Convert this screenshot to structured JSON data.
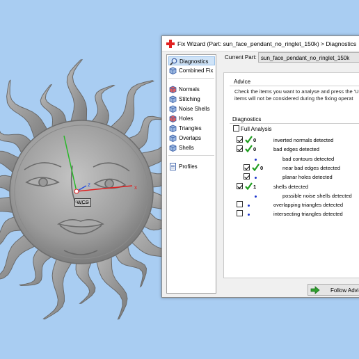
{
  "viewport": {
    "background": "#a9cdf2",
    "model_color": "#9a9a9a",
    "axes": {
      "x_label": "x",
      "z_label": "z",
      "x_color": "#e02020",
      "y_color": "#28b828",
      "z_color": "#2850e0"
    },
    "wcs_label": "WCS"
  },
  "dialog": {
    "title": "Fix Wizard (Part: sun_face_pendant_no_ringlet_150k) > Diagnostics",
    "title_icon": "red-cross-icon",
    "current_part_label": "Current Part:",
    "current_part_value": "sun_face_pendant_no_ringlet_150k",
    "nav": [
      {
        "label": "Diagnostics",
        "icon": "magnifier-icon",
        "selected": true
      },
      {
        "label": "Combined Fix",
        "icon": "cube-icon"
      },
      {
        "label": "Normals",
        "icon": "cube-icon"
      },
      {
        "label": "Stitching",
        "icon": "cube-icon"
      },
      {
        "label": "Noise Shells",
        "icon": "cube-icon"
      },
      {
        "label": "Holes",
        "icon": "cube-icon"
      },
      {
        "label": "Triangles",
        "icon": "cube-icon"
      },
      {
        "label": "Overlaps",
        "icon": "cube-icon"
      },
      {
        "label": "Shells",
        "icon": "cube-icon"
      },
      {
        "label": "Profiles",
        "icon": "document-icon"
      }
    ],
    "advice": {
      "title": "Advice",
      "line1": "Check the items you want to analyse and press the 'U",
      "line2": "items will not be considered during the fixing operat"
    },
    "diagnostics": {
      "title": "Diagnostics",
      "full_analysis_label": "Full Analysis",
      "full_analysis_checked": false,
      "rows": [
        {
          "label": "inverted normals detected",
          "checked": true,
          "ok": true,
          "count": "0"
        },
        {
          "label": "bad edges detected",
          "checked": true,
          "ok": true,
          "count": "0"
        },
        {
          "label": "bad contours detected",
          "sub": true,
          "checked": null,
          "ok": false,
          "count": ""
        },
        {
          "label": "near bad edges detected",
          "sub": true,
          "checked": true,
          "ok": true,
          "count": "0"
        },
        {
          "label": "planar holes detected",
          "sub": true,
          "checked": true,
          "ok": false,
          "count": ""
        },
        {
          "label": "shells detected",
          "checked": true,
          "ok": true,
          "count": "1"
        },
        {
          "label": "possible noise shells detected",
          "sub": true,
          "checked": null,
          "ok": false,
          "count": ""
        },
        {
          "label": "overlapping triangles detected",
          "checked": false,
          "ok": false,
          "count": ""
        },
        {
          "label": "intersecting triangles detected",
          "checked": false,
          "ok": false,
          "count": ""
        }
      ]
    },
    "follow_button": "Follow Advice",
    "colors": {
      "tick": "#1f9e1f",
      "dot": "#1a33cc",
      "nav_selected": "#cfe3f7"
    }
  }
}
